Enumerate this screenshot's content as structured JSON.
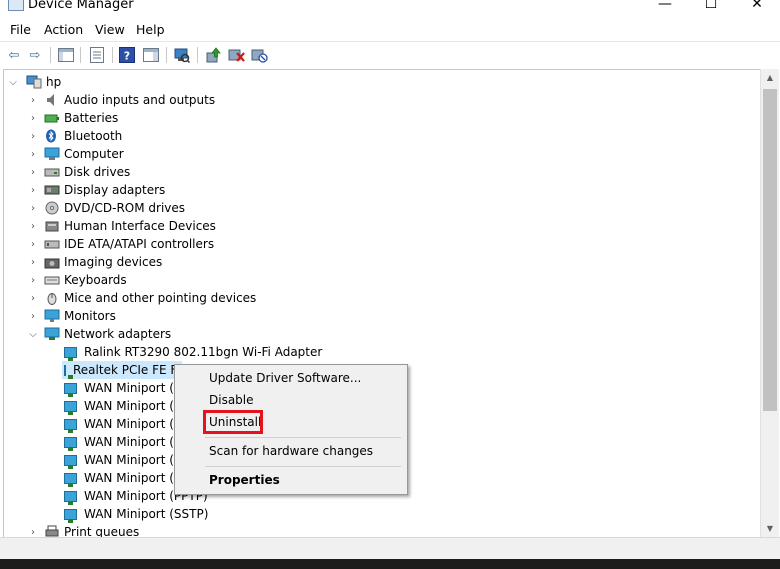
{
  "window": {
    "title": "Device Manager",
    "minimize": "—",
    "maximize": "☐",
    "close": "✕"
  },
  "menu": [
    "File",
    "Action",
    "View",
    "Help"
  ],
  "toolbar": {
    "icons": [
      "back-arrow",
      "forward-arrow",
      "show-hide-console-tree",
      "properties",
      "help",
      "action-pane",
      "scan-hardware",
      "update-driver",
      "uninstall-device",
      "disable-device"
    ]
  },
  "tree": {
    "root": "hp",
    "categories": [
      {
        "label": "Audio inputs and outputs",
        "icon": "speaker-icon"
      },
      {
        "label": "Batteries",
        "icon": "battery-icon"
      },
      {
        "label": "Bluetooth",
        "icon": "bluetooth-icon"
      },
      {
        "label": "Computer",
        "icon": "computer-icon"
      },
      {
        "label": "Disk drives",
        "icon": "disk-drive-icon"
      },
      {
        "label": "Display adapters",
        "icon": "display-adapter-icon"
      },
      {
        "label": "DVD/CD-ROM drives",
        "icon": "dvd-icon"
      },
      {
        "label": "Human Interface Devices",
        "icon": "hid-icon"
      },
      {
        "label": "IDE ATA/ATAPI controllers",
        "icon": "ide-icon"
      },
      {
        "label": "Imaging devices",
        "icon": "camera-icon"
      },
      {
        "label": "Keyboards",
        "icon": "keyboard-icon"
      },
      {
        "label": "Mice and other pointing devices",
        "icon": "mouse-icon"
      },
      {
        "label": "Monitors",
        "icon": "monitor-icon"
      },
      {
        "label": "Network adapters",
        "icon": "network-adapter-icon",
        "expanded": true
      }
    ],
    "network_children": [
      "Ralink RT3290 802.11bgn Wi-Fi Adapter",
      "Realtek PCIe FE Fa",
      "WAN Miniport (IK",
      "WAN Miniport (IP",
      "WAN Miniport (IP",
      "WAN Miniport (L",
      "WAN Miniport (N",
      "WAN Miniport (P",
      "WAN Miniport (PPTP)",
      "WAN Miniport (SSTP)"
    ],
    "after": "Print queues"
  },
  "context_menu": {
    "update": "Update Driver Software...",
    "disable": "Disable",
    "uninstall": "Uninstall",
    "scan": "Scan for hardware changes",
    "properties": "Properties"
  },
  "colors": {
    "selection": "#cce8ff",
    "highlight_box": "#e5131d"
  }
}
